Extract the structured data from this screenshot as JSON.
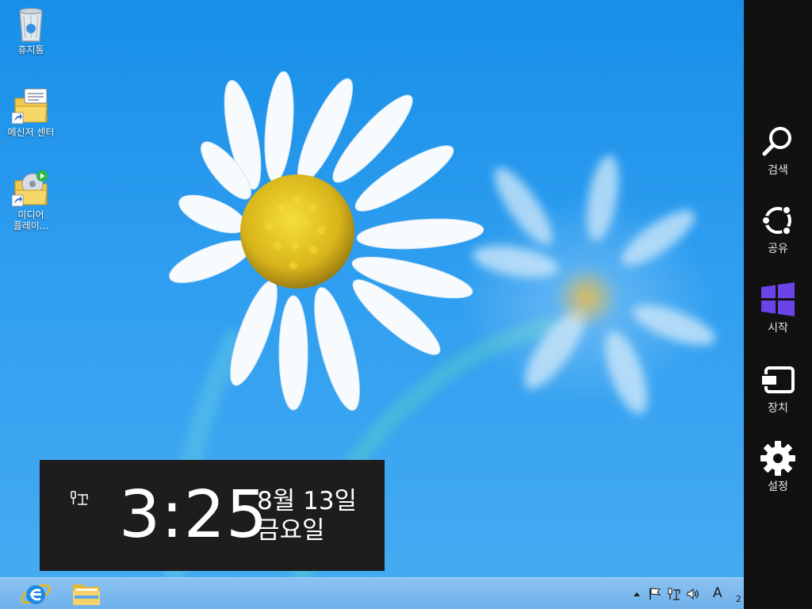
{
  "desktop": {
    "icons": [
      {
        "label": "휴지통"
      },
      {
        "label": "메신저 센터"
      },
      {
        "label": "미디어\n플레이..."
      }
    ]
  },
  "charms": [
    {
      "label": "검색",
      "icon": "search-icon"
    },
    {
      "label": "공유",
      "icon": "share-icon"
    },
    {
      "label": "시작",
      "icon": "windows-logo-icon"
    },
    {
      "label": "장치",
      "icon": "devices-icon"
    },
    {
      "label": "설정",
      "icon": "gear-icon"
    }
  ],
  "clock": {
    "time": "3:25",
    "date_line1": "8월 13일",
    "date_line2": "금요일"
  },
  "taskbar": {
    "pinned": [
      {
        "icon": "internet-explorer-icon"
      },
      {
        "icon": "file-explorer-icon"
      }
    ],
    "tray": {
      "ime": "A",
      "clock_fragment": "2"
    }
  },
  "colors": {
    "charms_bg": "#111111",
    "clock_bg": "#1d1d1d",
    "windows_logo": "#6a44e8",
    "taskbar": "#7fbbee",
    "wallpaper": "#2f9ef0"
  }
}
